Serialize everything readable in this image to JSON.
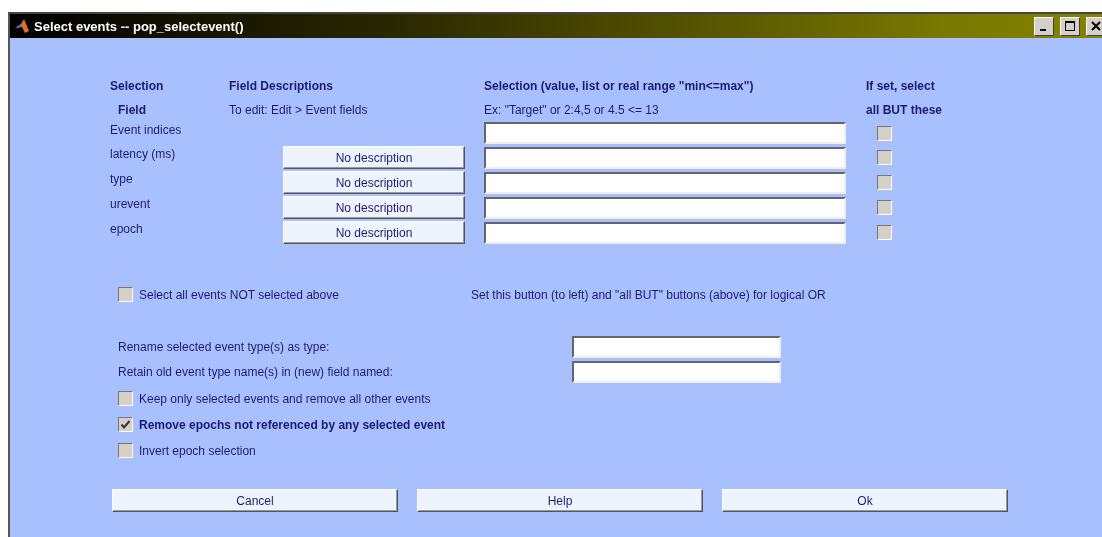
{
  "window": {
    "title": "Select events -- pop_selectevent()"
  },
  "header_columns": [
    {
      "title": "Selection",
      "subtitle": "Field",
      "subtitle_bold": true
    },
    {
      "title": "Field Descriptions",
      "subtitle": "To edit: Edit > Event fields",
      "subtitle_bold": false
    },
    {
      "title": "Selection (value, list or real range \"min<=max\")",
      "subtitle": "Ex: \"Target\" or 2:4,5  or  4.5 <= 13",
      "subtitle_bold": false
    },
    {
      "title": "If set, select",
      "subtitle": "all BUT these",
      "subtitle_bold": true
    }
  ],
  "fields": [
    {
      "name": "Event indices",
      "all_but": false
    },
    {
      "name": "latency (ms)",
      "description": "No description",
      "all_but": false
    },
    {
      "name": "type",
      "description": "No description",
      "all_but": false
    },
    {
      "name": "urevent",
      "description": "No description",
      "all_but": false
    },
    {
      "name": "epoch",
      "description": "No description",
      "all_but": false
    }
  ],
  "select_all_not": {
    "label": "Select all events NOT selected above",
    "checked": false
  },
  "logical_or_note": "Set this button (to left) and \"all BUT\" buttons (above) for logical OR",
  "rename_fields": [
    {
      "label": "Rename selected event type(s) as type:"
    },
    {
      "label": "Retain old event type name(s) in (new) field named:"
    }
  ],
  "options": [
    {
      "label": "Keep only selected events and remove all other events",
      "checked": false,
      "bold": false
    },
    {
      "label": "Remove epochs not referenced by any selected event",
      "checked": true,
      "bold": true
    },
    {
      "label": "Invert epoch selection",
      "checked": false,
      "bold": false
    }
  ],
  "buttons": [
    "Cancel",
    "Help",
    "Ok"
  ]
}
